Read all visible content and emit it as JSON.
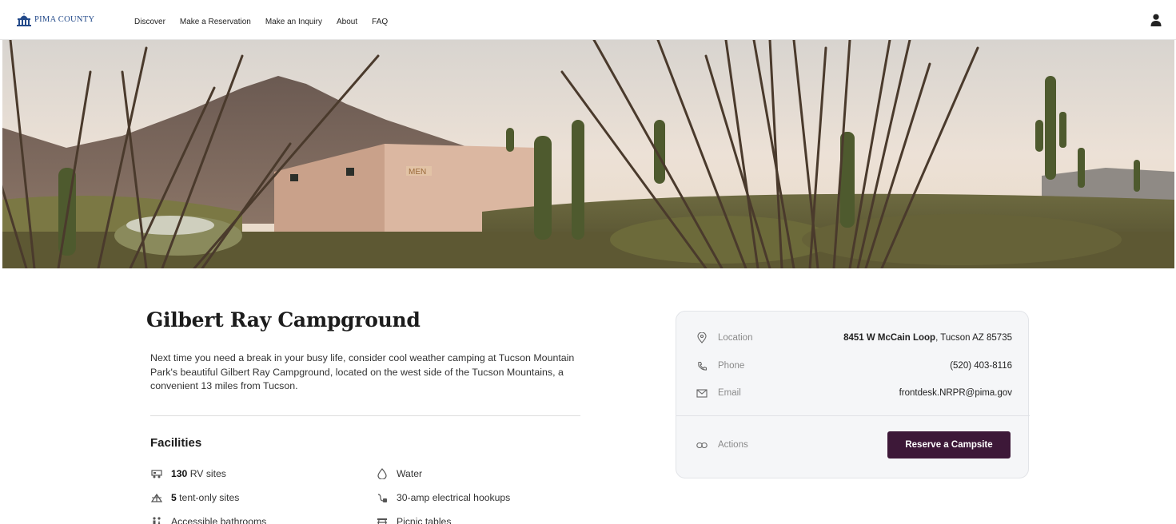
{
  "header": {
    "logo_text": "PIMA COUNTY",
    "nav": [
      "Discover",
      "Make a Reservation",
      "Make an Inquiry",
      "About",
      "FAQ"
    ],
    "user_icon": "person-icon"
  },
  "hero": {
    "sign_text": "MEN"
  },
  "campground": {
    "title": "Gilbert Ray Campground",
    "description": "Next time you need a break in your busy life, consider cool weather camping at Tucson Mountain Park's beautiful Gilbert Ray Campground, located on the west side of the Tucson Mountains, a convenient 13 miles from Tucson."
  },
  "facilities": {
    "title": "Facilities",
    "items": [
      {
        "count": "130",
        "label": " RV sites",
        "icon": "rv-icon"
      },
      {
        "count": "",
        "label": "Water",
        "icon": "water-drop-icon"
      },
      {
        "count": "5",
        "label": " tent-only sites",
        "icon": "tent-icon"
      },
      {
        "count": "",
        "label": "30-amp electrical hookups",
        "icon": "plug-icon"
      },
      {
        "count": "",
        "label": "Accessible bathrooms",
        "icon": "restroom-icon"
      },
      {
        "count": "",
        "label": "Picnic tables",
        "icon": "picnic-table-icon"
      }
    ]
  },
  "info": {
    "location_label": "Location",
    "location_value": "8451 W McCain Loop",
    "location_city": ", Tucson AZ 85735",
    "phone_label": "Phone",
    "phone_value": "(520) 403-8116",
    "email_label": "Email",
    "email_value": "frontdesk.NRPR@pima.gov",
    "actions_label": "Actions",
    "reserve_label": "Reserve a Campsite"
  },
  "colors": {
    "brand_blue": "#234a8a",
    "button": "#3d1838",
    "card_bg": "#f5f6f8"
  }
}
